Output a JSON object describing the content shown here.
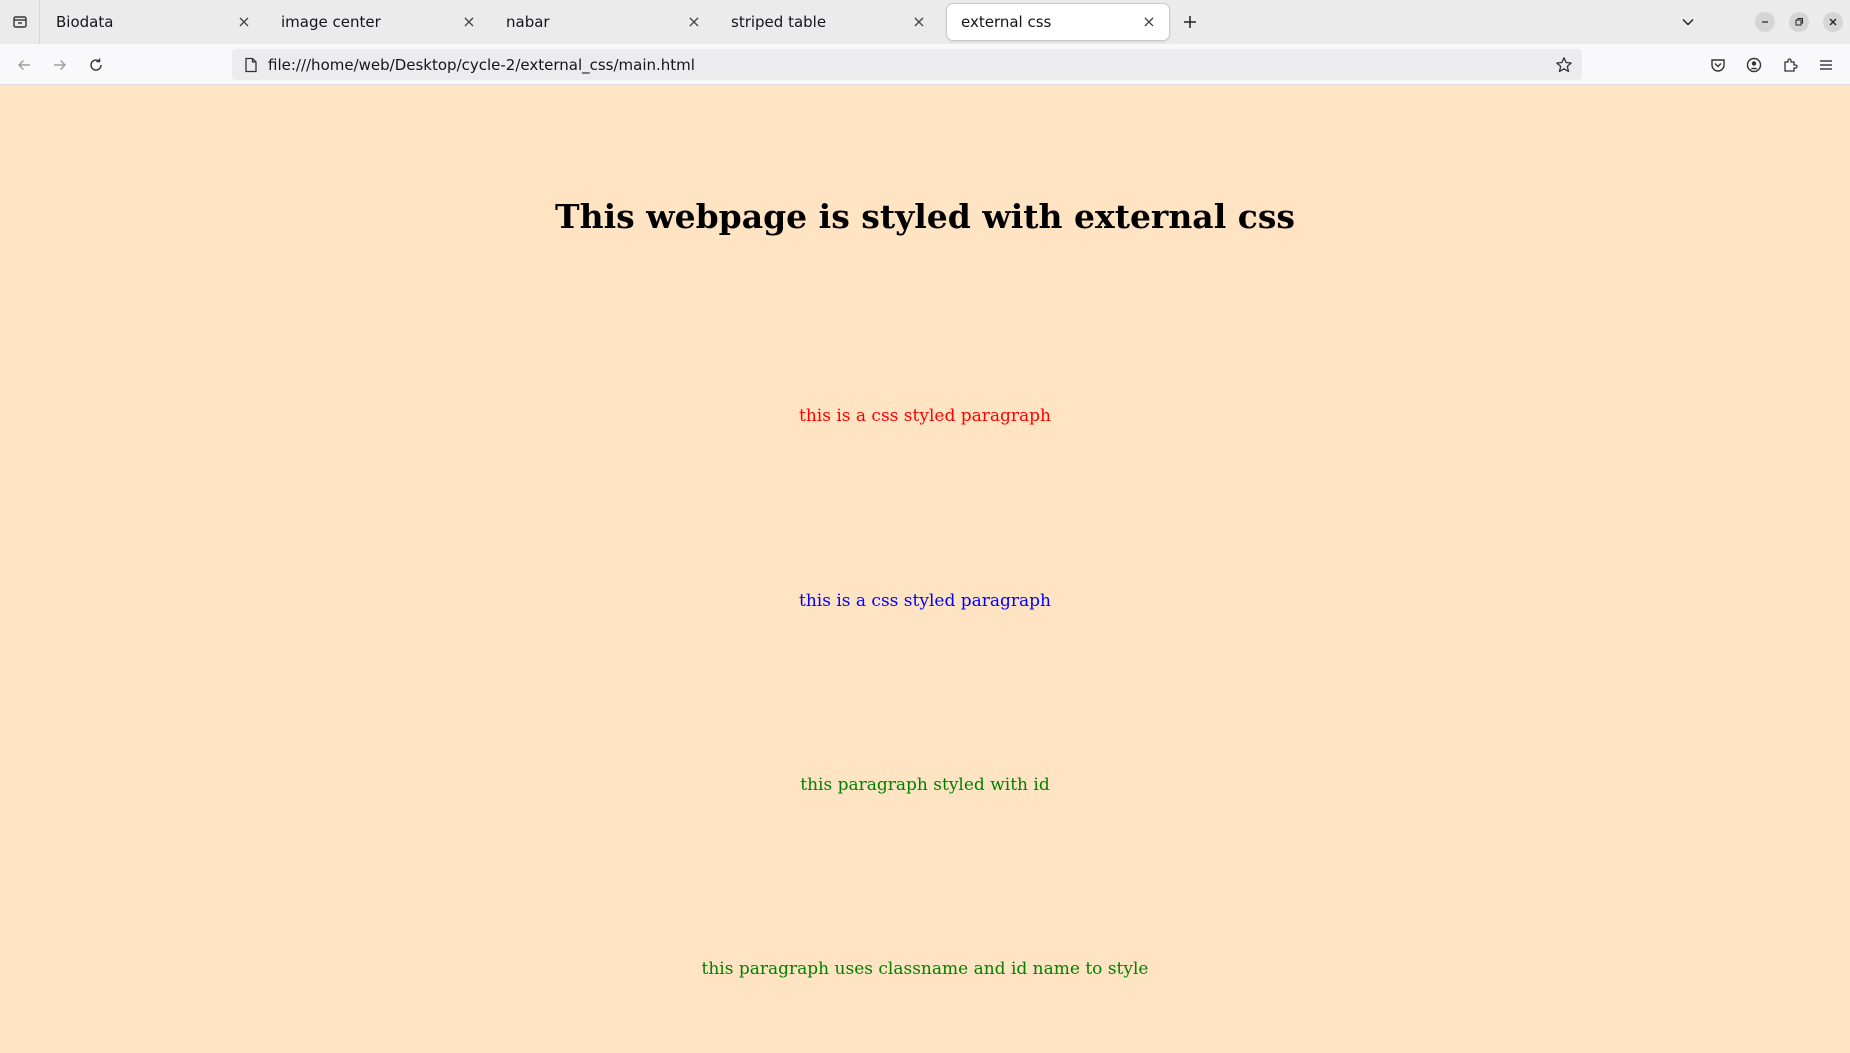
{
  "browser": {
    "tabs": [
      {
        "label": "Biodata",
        "active": false
      },
      {
        "label": "image center",
        "active": false
      },
      {
        "label": "nabar",
        "active": false
      },
      {
        "label": "striped table",
        "active": false
      },
      {
        "label": "external css",
        "active": true
      }
    ],
    "url": "file:///home/web/Desktop/cycle-2/external_css/main.html",
    "icons": {
      "tab_list": "tab-list-icon",
      "new_tab": "plus-icon",
      "tabs_overflow": "chevron-down-icon",
      "back": "back-arrow-icon",
      "forward": "forward-arrow-icon",
      "reload": "reload-icon",
      "page": "page-icon",
      "bookmark": "star-icon",
      "pocket": "pocket-icon",
      "account": "account-icon",
      "extensions": "extensions-icon",
      "menu": "hamburger-menu-icon",
      "minimize": "minimize-icon",
      "restore": "restore-icon",
      "close": "close-icon"
    }
  },
  "page": {
    "background": "#ffe4c4",
    "heading": "This webpage is styled with external css",
    "paragraphs": [
      {
        "text": "this is a css styled paragraph",
        "color": "#ff0000"
      },
      {
        "text": "this is a css styled paragraph",
        "color": "#0000ff"
      },
      {
        "text": "this paragraph styled with id",
        "color": "#008000"
      },
      {
        "text": "this paragraph uses classname and id name to style",
        "color": "#008000"
      }
    ]
  }
}
